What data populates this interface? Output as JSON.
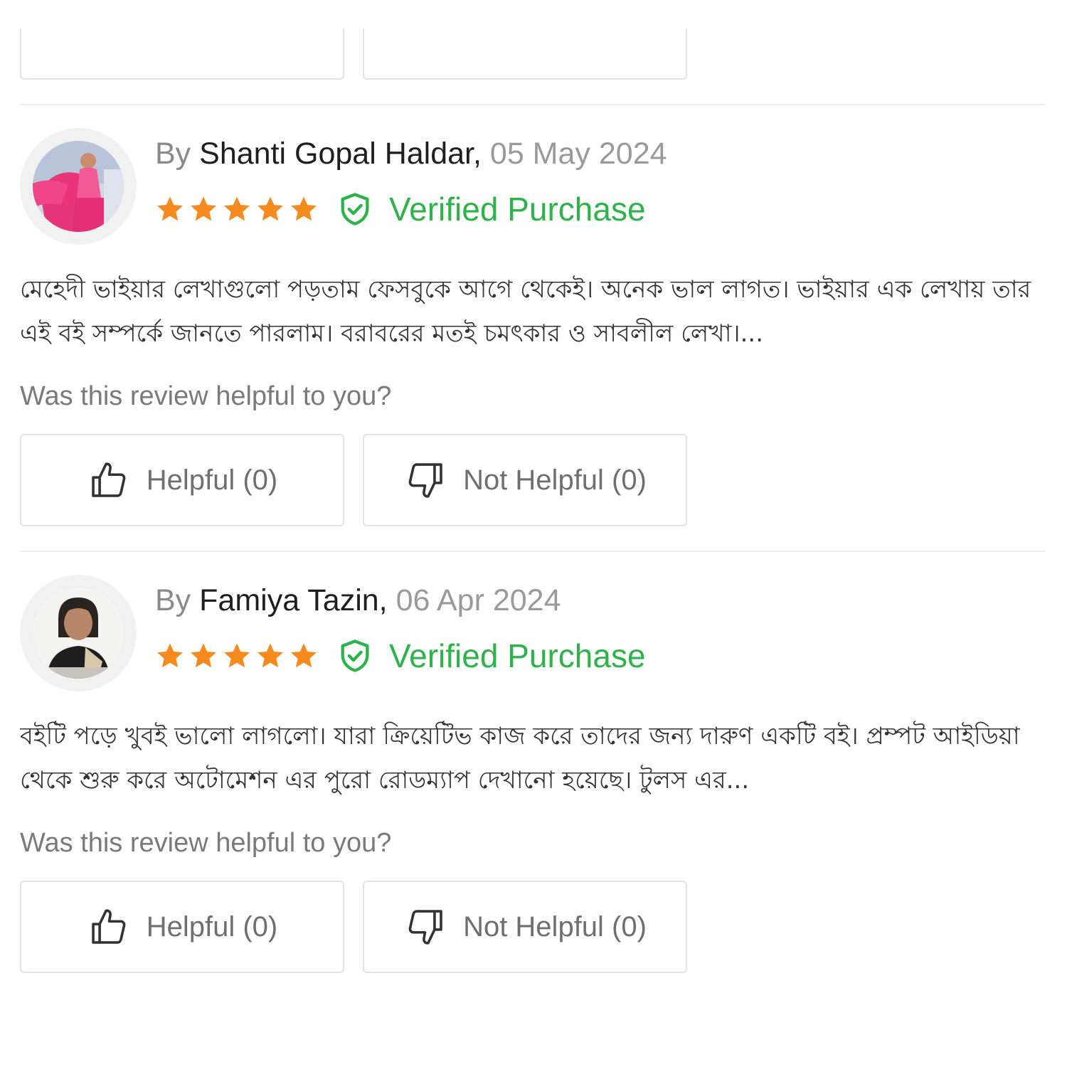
{
  "colors": {
    "verified_green": "#2fb24a",
    "star_orange": "#f58a1f",
    "border": "#e3e3e3",
    "muted_text": "#8a8a8a"
  },
  "reviews": [
    {
      "by_prefix": "By ",
      "author": "Shanti Gopal Haldar",
      "separator": ",",
      "date": "05 May 2024",
      "rating": 5,
      "verified_label": "Verified Purchase",
      "verified_icon": "shield-check-icon",
      "text": "মেহেদী ভাইয়ার লেখাগুলো পড়তাম ফেসবুকে আগে থেকেই। অনেক ভাল লাগত। ভাইয়ার এক লেখায় তার এই বই সম্পর্কে জানতে পারলাম। বরাবরের মতই চমৎকার ও সাবলীল লেখা।...",
      "helpful_question": "Was this review helpful to you?",
      "helpful_label": "Helpful (0)",
      "not_helpful_label": "Not Helpful (0)"
    },
    {
      "by_prefix": "By ",
      "author": "Famiya Tazin",
      "separator": ",",
      "date": "06 Apr 2024",
      "rating": 5,
      "verified_label": "Verified Purchase",
      "verified_icon": "shield-check-icon",
      "text": "বইটি পড়ে খুবই ভালো লাগলো। যারা ক্রিয়েটিভ কাজ করে তাদের জন্য দারুণ একটি বই। প্রম্পট আইডিয়া থেকে শুরু করে অটোমেশন এর পুরো রোডম্যাপ দেখানো হয়েছে। টুলস এর...",
      "helpful_question": "Was this review helpful to you?",
      "helpful_label": "Helpful (0)",
      "not_helpful_label": "Not Helpful (0)"
    }
  ]
}
